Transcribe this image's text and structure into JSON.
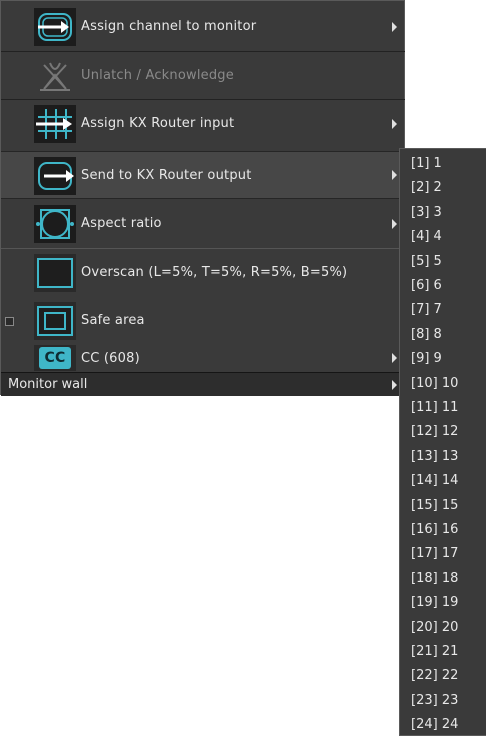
{
  "menu": {
    "items": [
      {
        "label": "Assign channel to monitor",
        "icon": "assign-channel-icon",
        "submenu": true
      },
      {
        "label": "Unlatch / Acknowledge",
        "icon": "unlatch-icon",
        "disabled": true
      },
      {
        "label": "Assign KX Router input",
        "icon": "router-input-icon",
        "submenu": true
      },
      {
        "label": "Send to KX Router output",
        "icon": "router-output-icon",
        "submenu": true
      },
      {
        "label": "Aspect ratio",
        "icon": "aspect-ratio-icon",
        "submenu": true
      },
      {
        "label": "Overscan (L=5%, T=5%, R=5%, B=5%)",
        "icon": "overscan-icon"
      },
      {
        "label": "Safe area",
        "icon": "safe-area-icon",
        "checkbox": true
      },
      {
        "label": "CC (608)",
        "icon": "cc-icon",
        "submenu": true
      }
    ],
    "wall_label": "Monitor wall",
    "cc_badge": "CC"
  },
  "submenu": {
    "items": [
      "[1] 1",
      "[2] 2",
      "[3] 3",
      "[4] 4",
      "[5] 5",
      "[6] 6",
      "[7] 7",
      "[8] 8",
      "[9] 9",
      "[10] 10",
      "[11] 11",
      "[12] 12",
      "[13] 13",
      "[14] 14",
      "[15] 15",
      "[16] 16",
      "[17] 17",
      "[18] 18",
      "[19] 19",
      "[20] 20",
      "[21] 21",
      "[22] 22",
      "[23] 23",
      "[24] 24"
    ]
  },
  "colors": {
    "accent": "#3fb6c8",
    "menu_bg": "#3a3a3a",
    "icon_bg": "#1c1c1c"
  }
}
